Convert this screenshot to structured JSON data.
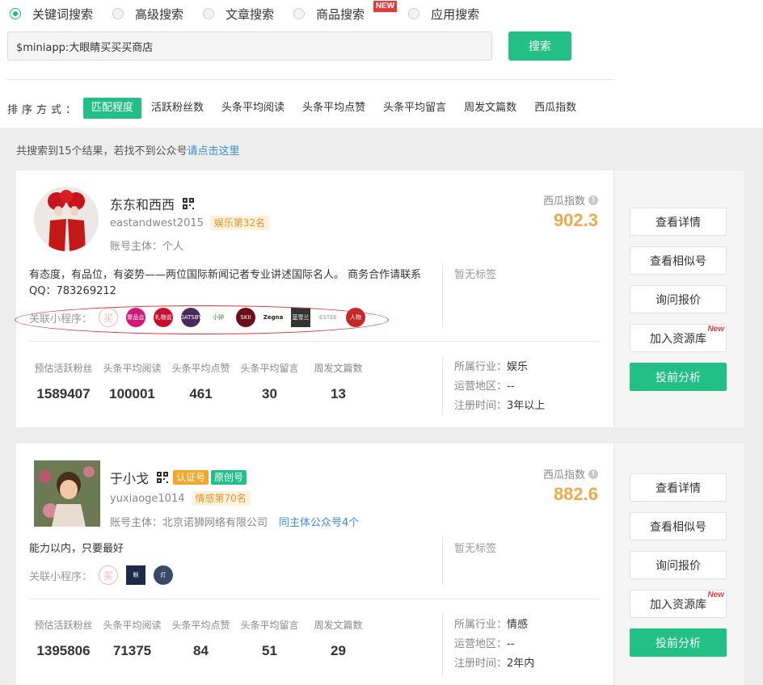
{
  "search_types": [
    {
      "label": "关键词搜索",
      "selected": true
    },
    {
      "label": "高级搜索",
      "selected": false
    },
    {
      "label": "文章搜索",
      "selected": false
    },
    {
      "label": "商品搜索",
      "selected": false,
      "badge": "NEW"
    },
    {
      "label": "应用搜索",
      "selected": false
    }
  ],
  "search": {
    "value": "$miniapp:大眼睛买买买商店",
    "button": "搜索"
  },
  "sort": {
    "label": "排序方式：",
    "options": [
      "匹配程度",
      "活跃粉丝数",
      "头条平均阅读",
      "头条平均点赞",
      "头条平均留言",
      "周发文篇数",
      "西瓜指数"
    ],
    "active": "匹配程度"
  },
  "result_summary": {
    "text": "共搜索到15个结果，若找不到公众号",
    "link": "请点击这里"
  },
  "labels": {
    "score": "西瓜指数",
    "owner_prefix": "账号主体：",
    "mini_programs": "关联小程序：",
    "no_tags": "暂无标签",
    "stat_labels": [
      "预估活跃粉丝",
      "头条平均阅读",
      "头条平均点赞",
      "头条平均留言",
      "周发文篇数"
    ],
    "industry": "所属行业：",
    "region": "运营地区：",
    "registered": "注册时间：",
    "actions": [
      "查看详情",
      "查看相似号",
      "询问报价",
      "加入资源库",
      "投前分析"
    ],
    "action_new": "New"
  },
  "accounts": [
    {
      "name": "东东和西西",
      "id": "eastandwest2015",
      "rank": "娱乐第32名",
      "owner": "个人",
      "score": "902.3",
      "description": "有态度，有品位，有姿势——两位国际新闻记者专业讲述国际名人。 商务合作请联系QQ：783269212",
      "mini_programs": [
        "买",
        "聚品会",
        "礼物说",
        "GATSBY",
        "小钟",
        "SKII",
        "Zegna",
        "蓝雪兰",
        "ESTEE",
        "人物"
      ],
      "stats": [
        "1589407",
        "100001",
        "461",
        "30",
        "13"
      ],
      "industry": "娱乐",
      "region": "--",
      "registered": "3年以上"
    },
    {
      "name": "于小戈",
      "badges": [
        "认证号",
        "原创号"
      ],
      "id": "yuxiaoge1014",
      "rank": "情感第70名",
      "owner": "北京诺狮网络有限公司",
      "owner_link": "同主体公众号4个",
      "score": "882.6",
      "description": "能力以内，只要最好",
      "mini_programs": [
        "买",
        "眼",
        "灯"
      ],
      "stats": [
        "1395806",
        "71375",
        "84",
        "51",
        "29"
      ],
      "industry": "情感",
      "region": "--",
      "registered": "2年内"
    }
  ]
}
